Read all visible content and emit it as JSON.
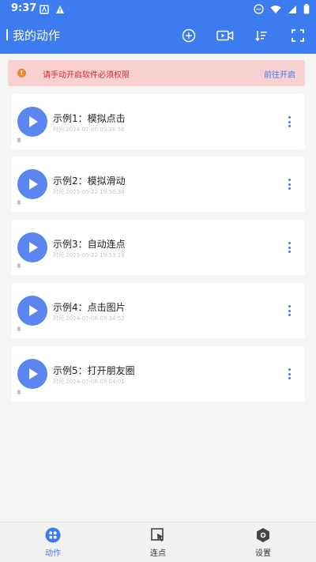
{
  "status_bar": {
    "time": "9:37"
  },
  "toolbar": {
    "title": "我的动作"
  },
  "alert": {
    "message": "请手动开启软件必须权限",
    "action": "前往开启",
    "icon_text": "!"
  },
  "actions": [
    {
      "title": "示例1：模拟点击",
      "time": "时间:2024-07-06 09:36:56"
    },
    {
      "title": "示例2：模拟滑动",
      "time": "时间:2025-05-22 19:50:38"
    },
    {
      "title": "示例3：自动连点",
      "time": "时间:2025-05-22 19:53:19"
    },
    {
      "title": "示例4：点击图片",
      "time": "时间:2024-07-06 09:34:52"
    },
    {
      "title": "示例5：打开朋友圈",
      "time": "时间:2024-07-06 09:04:01"
    }
  ],
  "bottom_nav": [
    {
      "label": "动作",
      "active": true
    },
    {
      "label": "连点",
      "active": false
    },
    {
      "label": "设置",
      "active": false
    }
  ],
  "colors": {
    "accent": "#3d7bf0",
    "alert_bg": "#f8d0d0",
    "alert_text": "#d12d2d",
    "play": "#5b86ef"
  }
}
